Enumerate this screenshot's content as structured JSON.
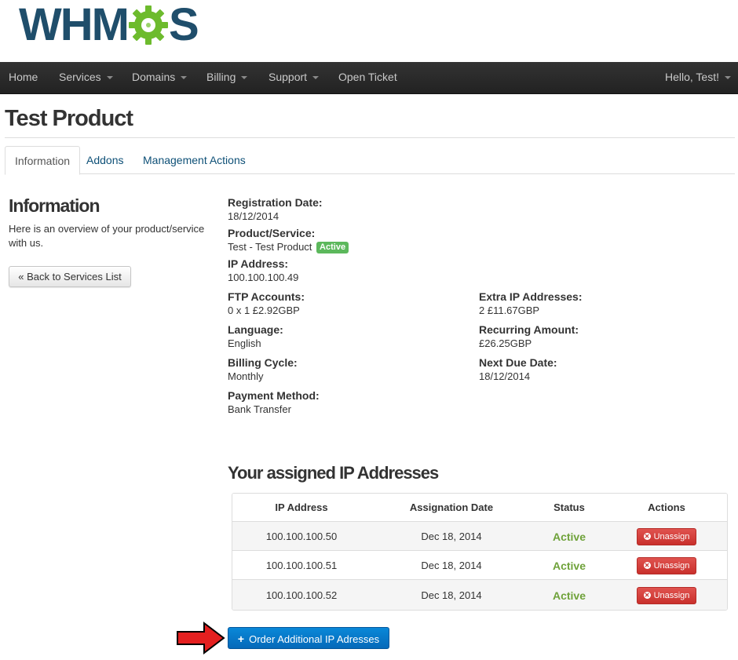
{
  "brand": {
    "logo_left": "WHM",
    "logo_right": "S",
    "colors": {
      "dark_blue": "#1f4e6b",
      "gear_green": "#6dbb2d"
    }
  },
  "nav": {
    "items": [
      {
        "label": "Home",
        "dropdown": false
      },
      {
        "label": "Services",
        "dropdown": true
      },
      {
        "label": "Domains",
        "dropdown": true
      },
      {
        "label": "Billing",
        "dropdown": true
      },
      {
        "label": "Support",
        "dropdown": true
      },
      {
        "label": "Open Ticket",
        "dropdown": false
      }
    ],
    "user_menu": "Hello, Test!"
  },
  "page": {
    "title": "Test Product",
    "tabs": [
      {
        "label": "Information",
        "active": true
      },
      {
        "label": "Addons",
        "active": false
      },
      {
        "label": "Management Actions",
        "active": false
      }
    ]
  },
  "sidebar": {
    "heading": "Information",
    "description": "Here is an overview of your product/service with us.",
    "back_button": "« Back to Services List"
  },
  "info": {
    "registration_date": {
      "label": "Registration Date:",
      "value": "18/12/2014"
    },
    "product_service": {
      "label": "Product/Service:",
      "value": "Test - Test Product",
      "badge": "Active"
    },
    "ip_address": {
      "label": "IP Address:",
      "value": "100.100.100.49"
    },
    "ftp_accounts": {
      "label": "FTP Accounts:",
      "value": "0 x 1 £2.92GBP"
    },
    "language": {
      "label": "Language:",
      "value": "English"
    },
    "billing_cycle": {
      "label": "Billing Cycle:",
      "value": "Monthly"
    },
    "payment_method": {
      "label": "Payment Method:",
      "value": "Bank Transfer"
    },
    "extra_ip": {
      "label": "Extra IP Addresses:",
      "value": "2 £11.67GBP"
    },
    "recurring_amount": {
      "label": "Recurring Amount:",
      "value": "£26.25GBP"
    },
    "next_due_date": {
      "label": "Next Due Date:",
      "value": "18/12/2014"
    }
  },
  "ip_section": {
    "heading": "Your assigned IP Addresses",
    "columns": [
      "IP Address",
      "Assignation Date",
      "Status",
      "Actions"
    ],
    "rows": [
      {
        "ip": "100.100.100.50",
        "date": "Dec 18, 2014",
        "status": "Active",
        "action": "Unassign"
      },
      {
        "ip": "100.100.100.51",
        "date": "Dec 18, 2014",
        "status": "Active",
        "action": "Unassign"
      },
      {
        "ip": "100.100.100.52",
        "date": "Dec 18, 2014",
        "status": "Active",
        "action": "Unassign"
      }
    ],
    "order_button": "Order Additional IP Adresses"
  }
}
